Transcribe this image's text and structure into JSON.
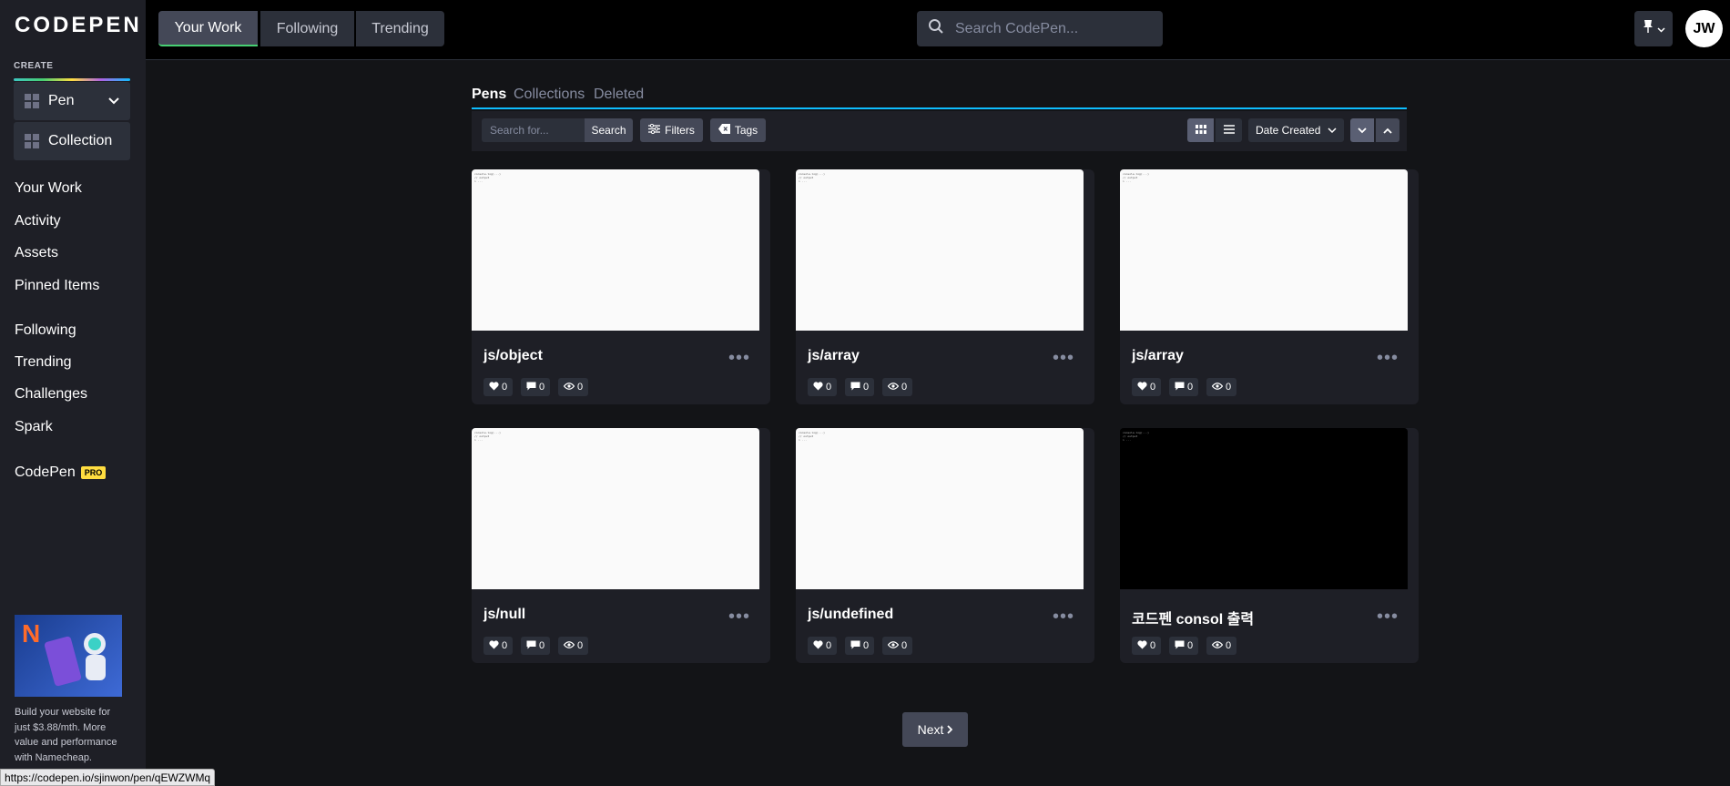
{
  "app": {
    "logo_text": "CODEPEN",
    "colors": {
      "accent_green": "#47cf73",
      "accent_blue": "#0ebeff",
      "pro_yellow": "#ffdd40"
    }
  },
  "sidebar": {
    "create_label": "CREATE",
    "create_pen": "Pen",
    "create_collection": "Collection",
    "nav_primary": [
      "Your Work",
      "Activity",
      "Assets",
      "Pinned Items"
    ],
    "nav_secondary": [
      "Following",
      "Trending",
      "Challenges",
      "Spark"
    ],
    "codepen_label": "CodePen",
    "pro_badge": "PRO",
    "ad_text": "Build your website for just $3.88/mth. More value and performance with Namecheap."
  },
  "header": {
    "tabs": [
      "Your Work",
      "Following",
      "Trending"
    ],
    "search_placeholder": "Search CodePen...",
    "avatar_initials": "JW"
  },
  "content": {
    "tabs": [
      "Pens",
      "Collections",
      "Deleted"
    ],
    "filter_placeholder": "Search for...",
    "search_button": "Search",
    "filters_button": "Filters",
    "tags_button": "Tags",
    "sort_label": "Date Created",
    "pens": [
      {
        "title": "js/object",
        "likes": "0",
        "comments": "0",
        "views": "0",
        "dark": false
      },
      {
        "title": "js/array",
        "likes": "0",
        "comments": "0",
        "views": "0",
        "dark": false
      },
      {
        "title": "js/array",
        "likes": "0",
        "comments": "0",
        "views": "0",
        "dark": false
      },
      {
        "title": "js/null",
        "likes": "0",
        "comments": "0",
        "views": "0",
        "dark": false
      },
      {
        "title": "js/undefined",
        "likes": "0",
        "comments": "0",
        "views": "0",
        "dark": false
      },
      {
        "title": "코드펜 consol 출력",
        "likes": "0",
        "comments": "0",
        "views": "0",
        "dark": true
      }
    ],
    "next_button": "Next"
  },
  "status_bar": {
    "url": "https://codepen.io/sjinwon/pen/qEWZWMq"
  }
}
